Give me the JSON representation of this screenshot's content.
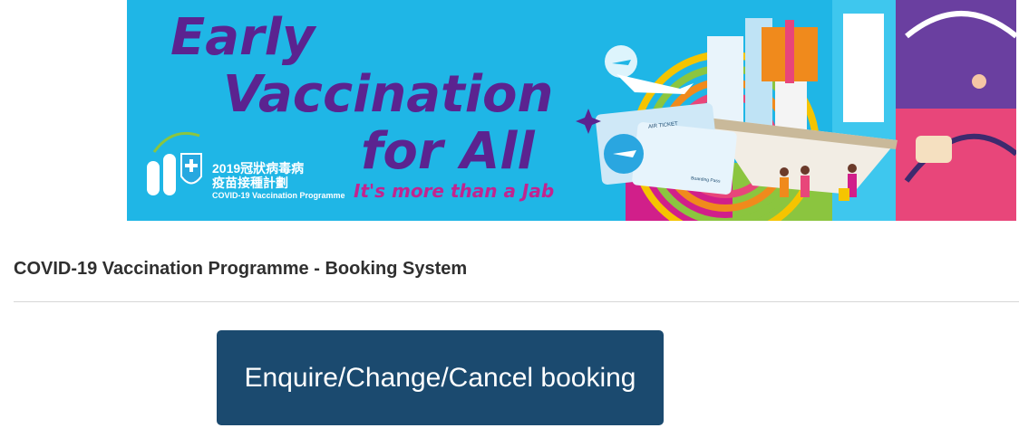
{
  "banner": {
    "headline_line1": "Early",
    "headline_line2": "Vaccination",
    "headline_line3": "for All",
    "tagline": "It's more than a Jab",
    "logo_cn_line1": "2019冠狀病毒病",
    "logo_cn_line2": "疫苗接種計劃",
    "logo_en": "COVID-19 Vaccination Programme",
    "ticket_label": "AIR TICKET",
    "boarding_label": "Boarding Pass",
    "colors": {
      "background": "#1fb6e6",
      "headline": "#5b2390",
      "tagline": "#c2248f"
    }
  },
  "page": {
    "title": "COVID-19 Vaccination Programme - Booking System"
  },
  "actions": {
    "enquire_label": "Enquire/Change/Cancel booking",
    "button_color": "#1b4a6f"
  }
}
